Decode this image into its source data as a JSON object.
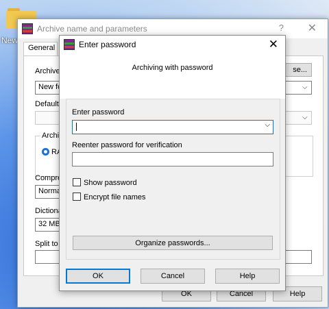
{
  "desktop": {
    "folder_label": "New"
  },
  "back_window": {
    "title": "Archive name and parameters",
    "help_glyph": "?",
    "close_glyph": "✕",
    "tab_general": "General",
    "archive_label": "Archive",
    "archive_value": "New fo",
    "browse_label": "se...",
    "default_label": "Default",
    "archive_format_label": "Archiv",
    "rar_label": "RA",
    "compression_label": "Compre",
    "compression_value": "Normal",
    "dictionary_label": "Dictiona",
    "dictionary_value": "32 MB",
    "split_label": "Split to",
    "ok_label": "OK",
    "cancel_label": "Cancel",
    "help_label": "Help"
  },
  "dialog": {
    "title": "Enter password",
    "close_glyph": "✕",
    "message": "Archiving with password",
    "enter_password_label": "Enter password",
    "enter_password_value": "",
    "reenter_label": "Reenter password for verification",
    "reenter_value": "",
    "show_password_label": "Show password",
    "show_password_checked": false,
    "encrypt_names_label": "Encrypt file names",
    "encrypt_names_checked": false,
    "organize_label": "Organize passwords...",
    "ok_label": "OK",
    "cancel_label": "Cancel",
    "help_label": "Help"
  },
  "icons": {
    "dropdown": "chevron-down-icon",
    "app": "winrar-icon",
    "folder": "folder-icon"
  }
}
